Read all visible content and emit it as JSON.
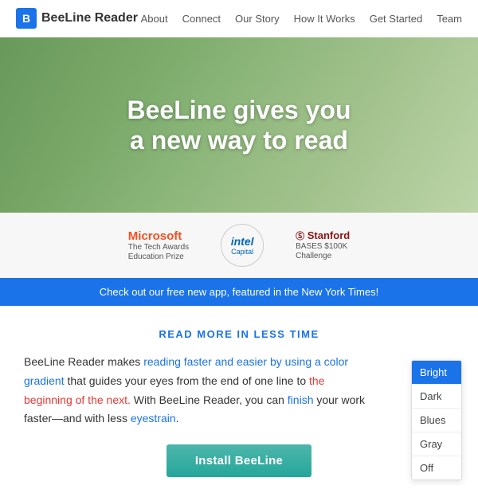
{
  "nav": {
    "logo_letter": "B",
    "logo_text": "BeeLine Reader",
    "links": [
      "About",
      "Connect",
      "Our Story",
      "How It Works",
      "Get Started",
      "Team"
    ]
  },
  "hero": {
    "title_line1": "BeeLine gives you",
    "title_line2": "a new way to read"
  },
  "partners": [
    {
      "id": "microsoft",
      "name": "Microsoft",
      "sub": "The Tech Awards\nEducation Prize"
    },
    {
      "id": "intel",
      "name": "intel",
      "sub": "Capital"
    },
    {
      "id": "stanford",
      "logo": "Stanford",
      "sub": "BASES $100K\nChallenge"
    }
  ],
  "banner": {
    "text": "Check out our free new app, featured in the New York Times!"
  },
  "main": {
    "section_label": "READ MORE IN LESS TIME",
    "body_text_1": "BeeLine Reader makes ",
    "body_text_highlight1": "reading faster and easier by using a color gradient",
    "body_text_2": " that guides your eyes from the end of one line to ",
    "body_text_highlight2": "the beginning of the next.",
    "body_text_3": " With BeeLine Reader, you can ",
    "body_text_highlight3": "finish",
    "body_text_4": " your work faster—and with less ",
    "body_text_highlight4": "eyestrain",
    "body_text_5": "."
  },
  "theme_panel": {
    "items": [
      {
        "label": "Bright",
        "active": true
      },
      {
        "label": "Dark",
        "active": false
      },
      {
        "label": "Blues",
        "active": false
      },
      {
        "label": "Gray",
        "active": false
      },
      {
        "label": "Off",
        "active": false
      }
    ]
  },
  "install_button": {
    "label": "Install BeeLine"
  }
}
